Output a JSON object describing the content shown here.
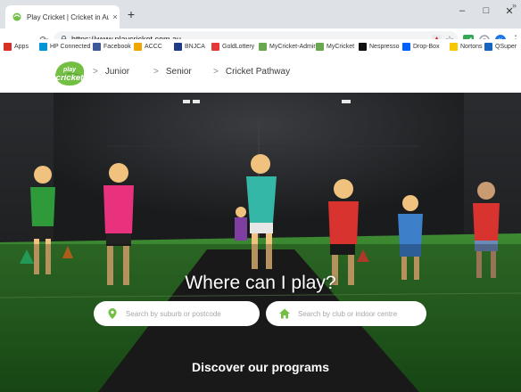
{
  "browser": {
    "tab": {
      "title": "Play Cricket | Cricket in Australia",
      "close_label": "×",
      "favicon": "cricket-favicon"
    },
    "new_tab_label": "+",
    "window_controls": {
      "minimize": "–",
      "maximize": "□",
      "close": "✕"
    },
    "url": "https://www.playcricket.com.au",
    "menu_label": "⋮",
    "profile_initial": "K",
    "bookmarks": [
      {
        "label": "Apps",
        "icon": "apps-grid-icon",
        "color": "#d93025"
      },
      {
        "label": "HP Connected",
        "icon": "hp-icon",
        "color": "#0096d6"
      },
      {
        "label": "Facebook",
        "icon": "facebook-icon",
        "color": "#3b5998"
      },
      {
        "label": "ACCC",
        "icon": "accc-icon",
        "color": "#f0a500"
      },
      {
        "label": "BNJCA",
        "icon": "bnjca-icon",
        "color": "#1f3c88"
      },
      {
        "label": "GoldLottery",
        "icon": "goldlottery-icon",
        "color": "#e53935"
      },
      {
        "label": "MyCricket-Admin",
        "icon": "cricket-icon",
        "color": "#6aa84f"
      },
      {
        "label": "MyCricket",
        "icon": "cricket-icon",
        "color": "#6aa84f"
      },
      {
        "label": "Nespresso",
        "icon": "nespresso-icon",
        "color": "#111111"
      },
      {
        "label": "Drop-Box",
        "icon": "dropbox-icon",
        "color": "#0061ff"
      },
      {
        "label": "Nortons",
        "icon": "norton-icon",
        "color": "#f7c800"
      },
      {
        "label": "QSuper",
        "icon": "qsuper-icon",
        "color": "#1565c0"
      }
    ],
    "bookmarks_more": "»"
  },
  "site": {
    "logo": {
      "line1": "play",
      "line2": "cricket",
      "color": "#72bf44"
    },
    "nav": [
      {
        "label": "Junior"
      },
      {
        "label": "Senior"
      },
      {
        "label": "Cricket Pathway"
      }
    ]
  },
  "hero": {
    "headline": "Where can I play?",
    "search_suburb": {
      "placeholder": "Search by suburb or postcode",
      "icon": "map-pin-icon"
    },
    "search_club": {
      "placeholder": "Search by club or indoor centre",
      "icon": "home-icon"
    },
    "discover_label": "Discover our programs",
    "accent": "#72bf44"
  }
}
